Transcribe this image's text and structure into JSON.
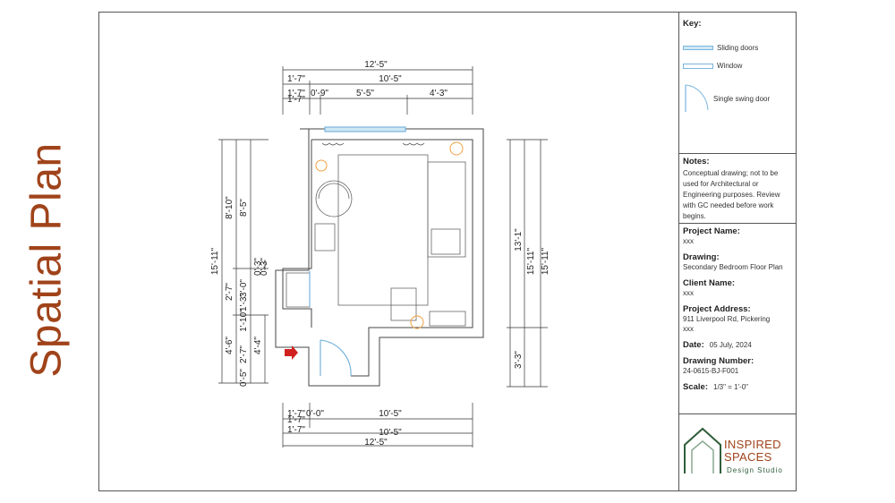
{
  "page_title": "Spatial Plan",
  "key": {
    "heading": "Key:",
    "items": [
      {
        "label": "Sliding doors",
        "icon": "sliding-door-icon"
      },
      {
        "label": "Window",
        "icon": "window-icon"
      },
      {
        "label": "Single swing door",
        "icon": "single-swing-door-icon"
      }
    ]
  },
  "notes": {
    "heading": "Notes:",
    "text": "Conceptual drawing; not to be used for Architectural or Engineering purposes. Review with GC needed before work begins."
  },
  "info": {
    "project_name_label": "Project Name:",
    "project_name": "xxx",
    "drawing_label": "Drawing:",
    "drawing": "Secondary Bedroom Floor Plan",
    "client_name_label": "Client Name:",
    "client_name": "xxx",
    "project_address_label": "Project Address:",
    "project_address_line1": "911 Liverpool Rd, Pickering",
    "project_address_line2": "xxx",
    "date_label": "Date:",
    "date": "05 July, 2024",
    "drawing_number_label": "Drawing Number:",
    "drawing_number": "24-0615-BJ-F001",
    "scale_label": "Scale:",
    "scale": "1/3\" = 1'-0\""
  },
  "logo": {
    "line1": "INSPIRED",
    "line2": "SPACES",
    "line3": "Design Studio"
  },
  "dimensions": {
    "top": [
      "12'-5\"",
      "1'-7\"",
      "10'-5\"",
      "1'-7\"",
      "0'-9\"",
      "5'-5\"",
      "4'-3\"",
      "1'-7\""
    ],
    "bottom": [
      "1'-7\"",
      "0'-0\"",
      "10'-5\"",
      "1'-7\"",
      "1'-7\"",
      "10'-5\"",
      "12'-5\""
    ],
    "left": [
      "15'-11\"",
      "8'-10\"",
      "8'-5\"",
      "0'-3\"",
      "0'-3\"",
      "2'-7\"",
      "1'-3\"",
      "3'-0\"",
      "1'-10\"",
      "4'-6\"",
      "2'-7\"",
      "4'-4\"",
      "0'-5\""
    ],
    "right": [
      "13'-1\"",
      "15'-11\"",
      "15'-11\"",
      "3'-3\""
    ]
  },
  "colors": {
    "accent": "#a0431a",
    "glazing": "#7ab5dd",
    "fixture": "#f0a040",
    "entry_arrow": "#d02020",
    "logo_green": "#2f5e3a"
  }
}
